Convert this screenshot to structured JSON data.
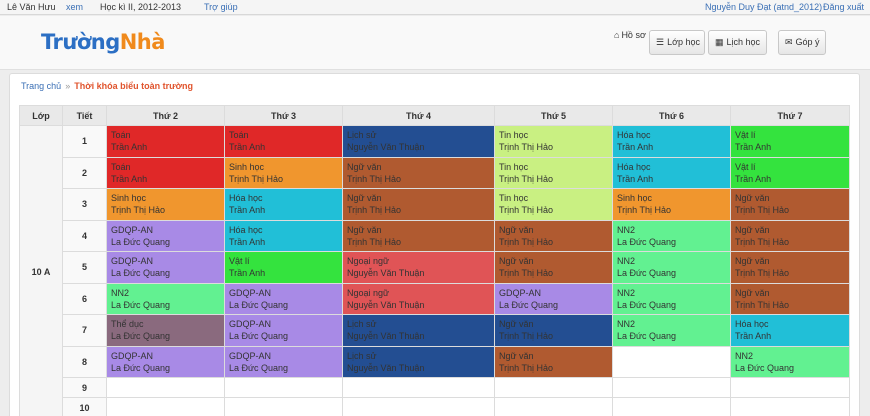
{
  "topbar": {
    "user": "Lê Văn Hưu",
    "view_link": "xem",
    "term": "Học kì II, 2012-2013",
    "help": "Trợ giúp",
    "account": "Nguyễn Duy Đạt (atnd_2012)",
    "logout": "Đăng xuất"
  },
  "header": {
    "logo_part1": "Trường",
    "logo_part2": "Nhà",
    "profile": "Hồ sơ",
    "class_button": "Lớp học",
    "schedule_button": "Lịch học",
    "feedback_button": "Góp ý"
  },
  "breadcrumb": {
    "home": "Trang chủ",
    "separator": "»",
    "current": "Thời khóa biểu toàn trường"
  },
  "timetable": {
    "headers": [
      "Lớp",
      "Tiết",
      "Thứ 2",
      "Thứ 3",
      "Thứ 4",
      "Thứ 5",
      "Thứ 6",
      "Thứ 7"
    ],
    "class_name": "10 A",
    "periods": [
      {
        "period": "1",
        "cells": [
          {
            "subject": "Toán",
            "teacher": "Trần Anh",
            "color": "#e02828"
          },
          {
            "subject": "Toán",
            "teacher": "Trần Anh",
            "color": "#e02828"
          },
          {
            "subject": "Lịch sử",
            "teacher": "Nguyễn Văn Thuận",
            "color": "#234e92"
          },
          {
            "subject": "Tin học",
            "teacher": "Trịnh Thị Hảo",
            "color": "#c9f082"
          },
          {
            "subject": "Hóa học",
            "teacher": "Trần Anh",
            "color": "#21bfd7"
          },
          {
            "subject": "Vật lí",
            "teacher": "Trần Anh",
            "color": "#34e33e"
          }
        ]
      },
      {
        "period": "2",
        "cells": [
          {
            "subject": "Toán",
            "teacher": "Trần Anh",
            "color": "#e02828"
          },
          {
            "subject": "Sinh học",
            "teacher": "Trịnh Thị Hảo",
            "color": "#f0962e"
          },
          {
            "subject": "Ngữ văn",
            "teacher": "Trịnh Thị Hảo",
            "color": "#b05a30"
          },
          {
            "subject": "Tin học",
            "teacher": "Trịnh Thị Hảo",
            "color": "#c9f082"
          },
          {
            "subject": "Hóa học",
            "teacher": "Trần Anh",
            "color": "#21bfd7"
          },
          {
            "subject": "Vật lí",
            "teacher": "Trần Anh",
            "color": "#34e33e"
          }
        ]
      },
      {
        "period": "3",
        "cells": [
          {
            "subject": "Sinh học",
            "teacher": "Trịnh Thị Hảo",
            "color": "#f0962e"
          },
          {
            "subject": "Hóa học",
            "teacher": "Trần Anh",
            "color": "#21bfd7"
          },
          {
            "subject": "Ngữ văn",
            "teacher": "Trịnh Thị Hảo",
            "color": "#b05a30"
          },
          {
            "subject": "Tin học",
            "teacher": "Trịnh Thị Hảo",
            "color": "#c9f082"
          },
          {
            "subject": "Sinh học",
            "teacher": "Trịnh Thị Hảo",
            "color": "#f0962e"
          },
          {
            "subject": "Ngữ văn",
            "teacher": "Trịnh Thị Hảo",
            "color": "#b05a30"
          }
        ]
      },
      {
        "period": "4",
        "cells": [
          {
            "subject": "GDQP-AN",
            "teacher": "La Đức Quang",
            "color": "#a88ae6"
          },
          {
            "subject": "Hóa học",
            "teacher": "Trần Anh",
            "color": "#21bfd7"
          },
          {
            "subject": "Ngữ văn",
            "teacher": "Trịnh Thị Hảo",
            "color": "#b05a30"
          },
          {
            "subject": "Ngữ văn",
            "teacher": "Trịnh Thị Hảo",
            "color": "#b05a30"
          },
          {
            "subject": "NN2",
            "teacher": "La Đức Quang",
            "color": "#62f191"
          },
          {
            "subject": "Ngữ văn",
            "teacher": "Trịnh Thị Hảo",
            "color": "#b05a30"
          }
        ]
      },
      {
        "period": "5",
        "cells": [
          {
            "subject": "GDQP-AN",
            "teacher": "La Đức Quang",
            "color": "#a88ae6"
          },
          {
            "subject": "Vật lí",
            "teacher": "Trần Anh",
            "color": "#34e33e"
          },
          {
            "subject": "Ngoại ngữ",
            "teacher": "Nguyễn Văn Thuận",
            "color": "#e05456"
          },
          {
            "subject": "Ngữ văn",
            "teacher": "Trịnh Thị Hảo",
            "color": "#b05a30"
          },
          {
            "subject": "NN2",
            "teacher": "La Đức Quang",
            "color": "#62f191"
          },
          {
            "subject": "Ngữ văn",
            "teacher": "Trịnh Thị Hảo",
            "color": "#b05a30"
          }
        ]
      },
      {
        "period": "6",
        "cells": [
          {
            "subject": "NN2",
            "teacher": "La Đức Quang",
            "color": "#62f191"
          },
          {
            "subject": "GDQP-AN",
            "teacher": "La Đức Quang",
            "color": "#a88ae6"
          },
          {
            "subject": "Ngoại ngữ",
            "teacher": "Nguyễn Văn Thuận",
            "color": "#e05456"
          },
          {
            "subject": "GDQP-AN",
            "teacher": "La Đức Quang",
            "color": "#a88ae6"
          },
          {
            "subject": "NN2",
            "teacher": "La Đức Quang",
            "color": "#62f191"
          },
          {
            "subject": "Ngữ văn",
            "teacher": "Trịnh Thị Hảo",
            "color": "#b05a30"
          }
        ]
      },
      {
        "period": "7",
        "cells": [
          {
            "subject": "Thể dục",
            "teacher": "La Đức Quang",
            "color": "#8a6a7e"
          },
          {
            "subject": "GDQP-AN",
            "teacher": "La Đức Quang",
            "color": "#a88ae6"
          },
          {
            "subject": "Lịch sử",
            "teacher": "Nguyễn Văn Thuận",
            "color": "#234e92"
          },
          {
            "subject": "Ngữ văn",
            "teacher": "Trịnh Thị Hảo",
            "color": "#234e92"
          },
          {
            "subject": "NN2",
            "teacher": "La Đức Quang",
            "color": "#62f191"
          },
          {
            "subject": "Hóa học",
            "teacher": "Trần Anh",
            "color": "#21bfd7"
          }
        ]
      },
      {
        "period": "8",
        "cells": [
          {
            "subject": "GDQP-AN",
            "teacher": "La Đức Quang",
            "color": "#a88ae6"
          },
          {
            "subject": "GDQP-AN",
            "teacher": "La Đức Quang",
            "color": "#a88ae6"
          },
          {
            "subject": "Lịch sử",
            "teacher": "Nguyễn Văn Thuận",
            "color": "#234e92"
          },
          {
            "subject": "Ngữ văn",
            "teacher": "Trịnh Thị Hảo",
            "color": "#b05a30"
          },
          null,
          {
            "subject": "NN2",
            "teacher": "La Đức Quang",
            "color": "#62f191"
          }
        ]
      },
      {
        "period": "9",
        "cells": [
          null,
          null,
          null,
          null,
          null,
          null
        ]
      },
      {
        "period": "10",
        "cells": [
          null,
          null,
          null,
          null,
          null,
          null
        ]
      }
    ]
  }
}
